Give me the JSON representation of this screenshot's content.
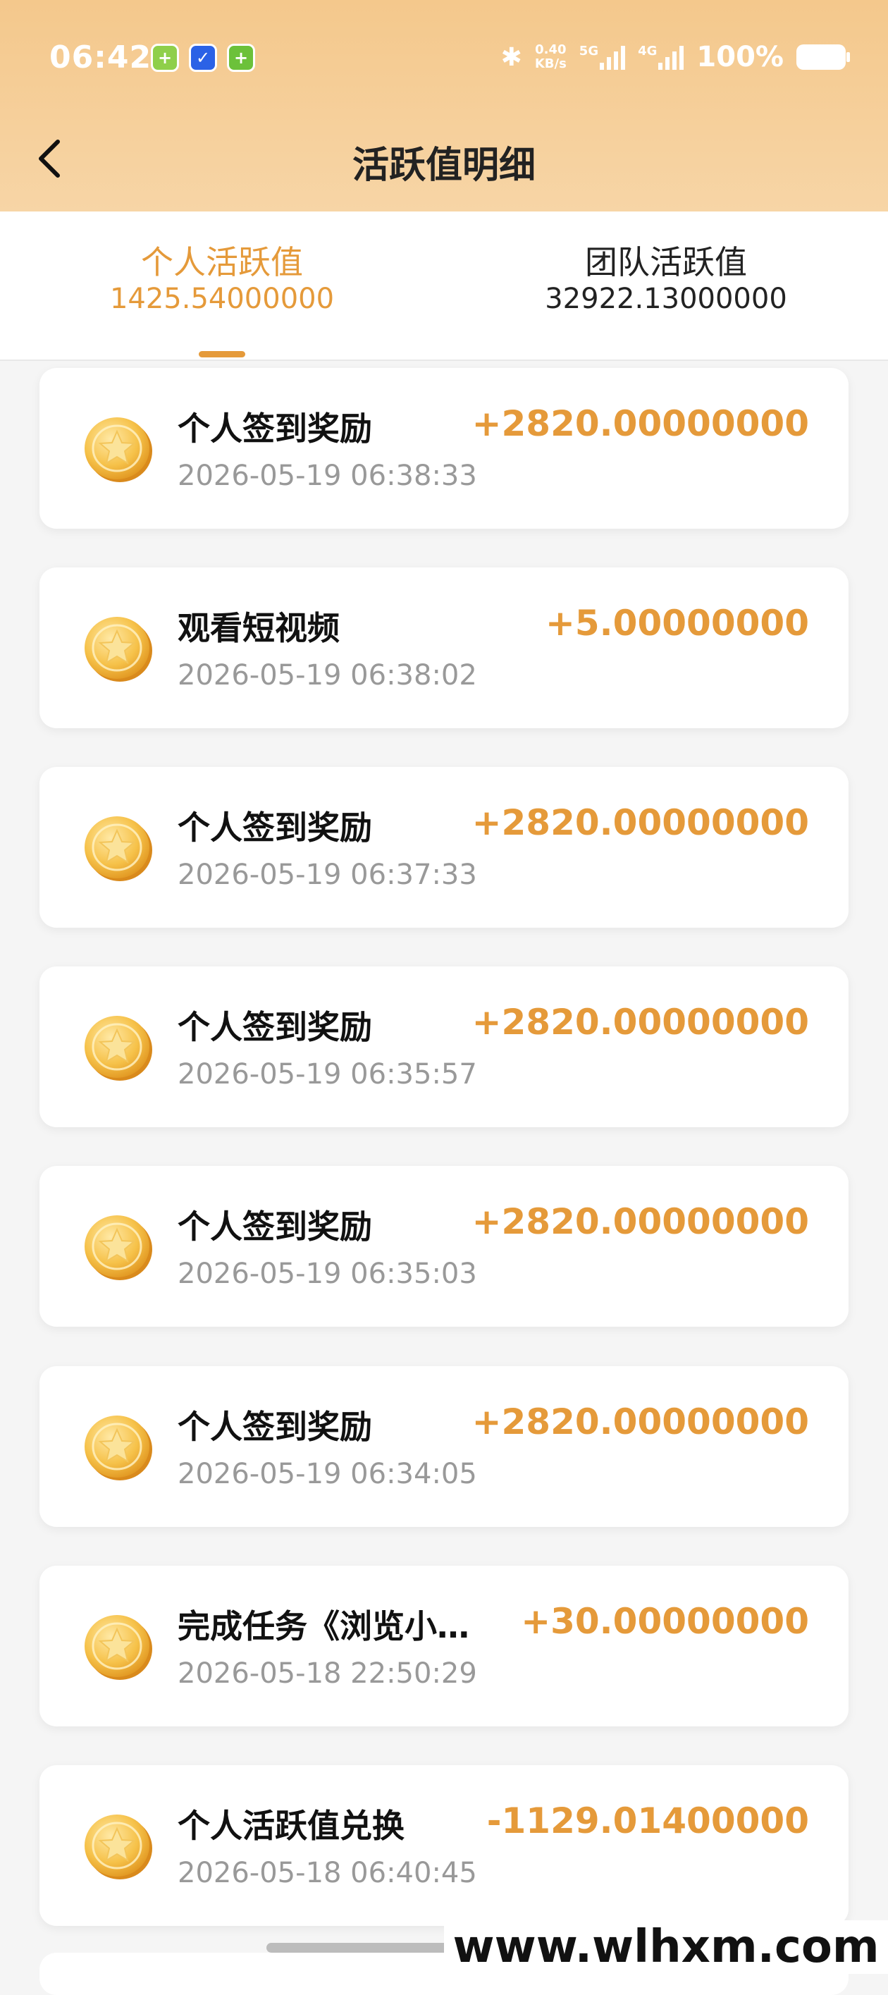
{
  "status_bar": {
    "time": "06:42",
    "network_speed": "0.40",
    "network_unit": "KB/s",
    "sim1_label": "5G",
    "sim2_label": "4G",
    "battery": "100%"
  },
  "header": {
    "title": "活跃值明细"
  },
  "tabs": [
    {
      "label": "个人活跃值",
      "value": "1425.54000000",
      "active": true
    },
    {
      "label": "团队活跃值",
      "value": "32922.13000000",
      "active": false
    }
  ],
  "records": [
    {
      "title": "个人签到奖励",
      "time": "2026-05-19 06:38:33",
      "amount": "+2820.00000000"
    },
    {
      "title": "观看短视频",
      "time": "2026-05-19 06:38:02",
      "amount": "+5.00000000"
    },
    {
      "title": "个人签到奖励",
      "time": "2026-05-19 06:37:33",
      "amount": "+2820.00000000"
    },
    {
      "title": "个人签到奖励",
      "time": "2026-05-19 06:35:57",
      "amount": "+2820.00000000"
    },
    {
      "title": "个人签到奖励",
      "time": "2026-05-19 06:35:03",
      "amount": "+2820.00000000"
    },
    {
      "title": "个人签到奖励",
      "time": "2026-05-19 06:34:05",
      "amount": "+2820.00000000"
    },
    {
      "title": "完成任务《浏览小…",
      "time": "2026-05-18 22:50:29",
      "amount": "+30.00000000"
    },
    {
      "title": "个人活跃值兑换",
      "time": "2026-05-18 06:40:45",
      "amount": "-1129.01400000"
    }
  ],
  "watermark": "www.wlhxm.com",
  "colors": {
    "accent": "#e59a3a",
    "header_bg": "#f4c88c"
  }
}
